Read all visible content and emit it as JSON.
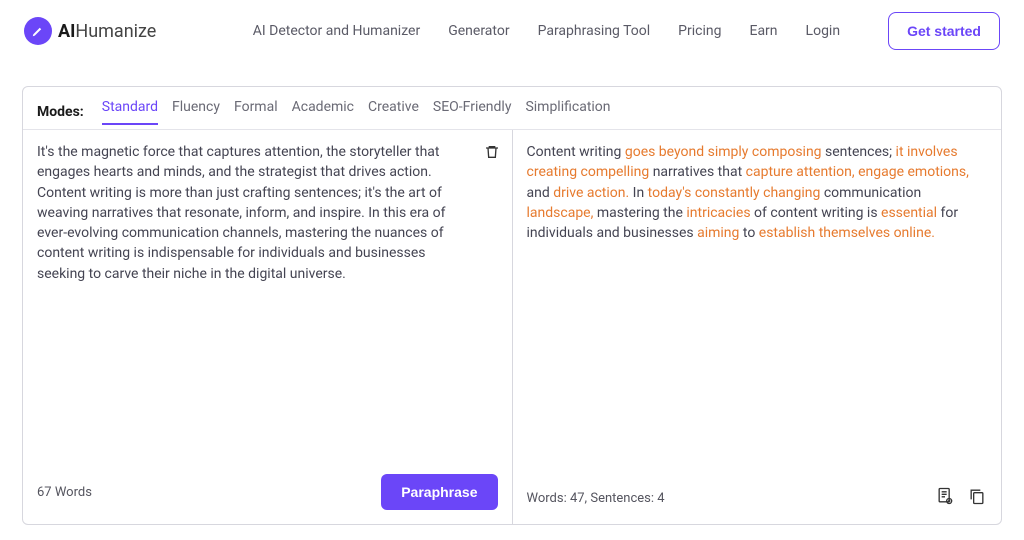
{
  "brand": {
    "strong": "AI",
    "rest": "Humanize"
  },
  "nav": {
    "items": [
      "AI Detector and Humanizer",
      "Generator",
      "Paraphrasing Tool",
      "Pricing",
      "Earn",
      "Login"
    ],
    "cta": "Get started"
  },
  "modes": {
    "label": "Modes:",
    "tabs": [
      "Standard",
      "Fluency",
      "Formal",
      "Academic",
      "Creative",
      "SEO-Friendly",
      "Simplification"
    ],
    "active_index": 0
  },
  "input": {
    "text": "It's the magnetic force that captures attention, the storyteller that engages hearts and minds, and the strategist that drives action. Content writing is more than just crafting sentences; it's the art of weaving narratives that resonate, inform, and inspire. In this era of ever-evolving communication channels, mastering the nuances of content writing is indispensable for individuals and businesses seeking to carve their niche in the digital universe.",
    "word_count_label": "67 Words",
    "action": "Paraphrase"
  },
  "output": {
    "segments": [
      {
        "t": "Content writing ",
        "h": false
      },
      {
        "t": "goes beyond simply composing",
        "h": true
      },
      {
        "t": " sentences; ",
        "h": false
      },
      {
        "t": "it involves creating compelling",
        "h": true
      },
      {
        "t": " narratives that ",
        "h": false
      },
      {
        "t": "capture attention, engage emotions,",
        "h": true
      },
      {
        "t": " and ",
        "h": false
      },
      {
        "t": "drive action.",
        "h": true
      },
      {
        "t": " In ",
        "h": false
      },
      {
        "t": "today's constantly changing",
        "h": true
      },
      {
        "t": " communication ",
        "h": false
      },
      {
        "t": "landscape,",
        "h": true
      },
      {
        "t": " mastering the ",
        "h": false
      },
      {
        "t": "intricacies",
        "h": true
      },
      {
        "t": " of content writing is ",
        "h": false
      },
      {
        "t": "essential",
        "h": true
      },
      {
        "t": " for individuals and businesses ",
        "h": false
      },
      {
        "t": "aiming",
        "h": true
      },
      {
        "t": " to ",
        "h": false
      },
      {
        "t": "establish themselves online.",
        "h": true
      }
    ],
    "stats_label": "Words: 47, Sentences: 4"
  }
}
